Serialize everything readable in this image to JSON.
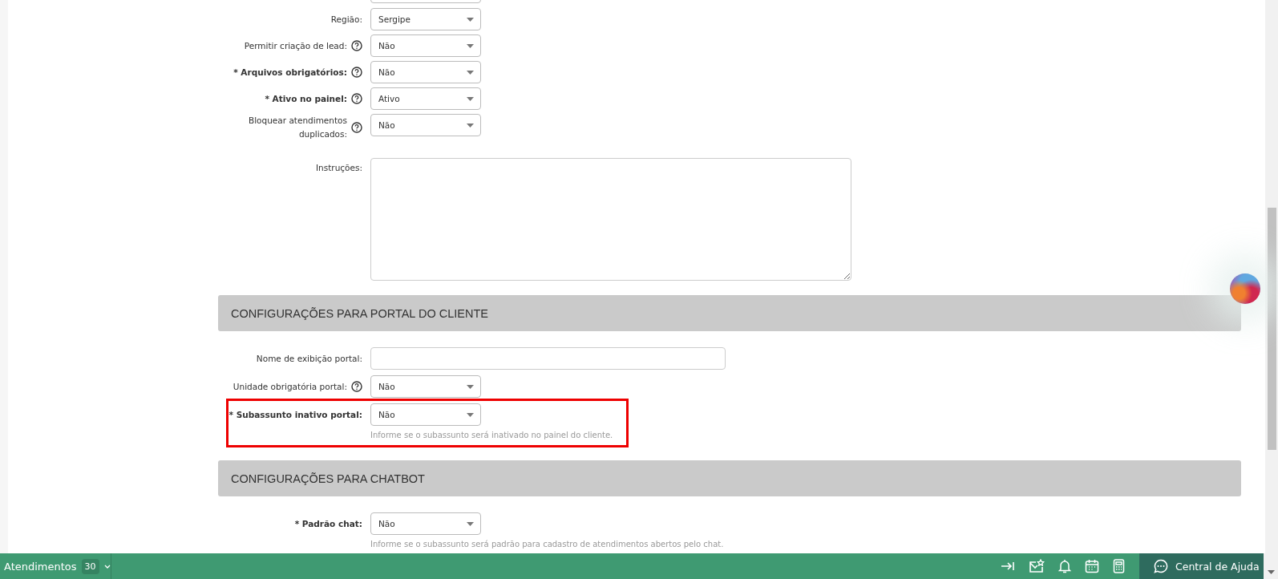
{
  "top_fields": [
    {
      "kind": "partial"
    },
    {
      "kind": "select",
      "label": "Região:",
      "required": false,
      "help": false,
      "value": "Sergipe"
    },
    {
      "kind": "select",
      "label": "Permitir criação de lead:",
      "required": false,
      "help": true,
      "value": "Não"
    },
    {
      "kind": "select",
      "label": "* Arquivos obrigatórios:",
      "required": true,
      "help": true,
      "value": "Não"
    },
    {
      "kind": "select",
      "label": "* Ativo no painel:",
      "required": true,
      "help": true,
      "value": "Ativo"
    },
    {
      "kind": "select",
      "label": "Bloquear atendimentos duplicados:",
      "required": false,
      "help": true,
      "value": "Não"
    },
    {
      "kind": "textarea",
      "label": "Instruções:",
      "required": false,
      "help": false
    }
  ],
  "sections": [
    {
      "title": "CONFIGURAÇÕES PARA PORTAL DO CLIENTE",
      "fields": [
        {
          "kind": "text",
          "label": "Nome de exibição portal:",
          "required": false,
          "help": false,
          "highlighted": false
        },
        {
          "kind": "select",
          "label": "Unidade obrigatória portal:",
          "required": false,
          "help": true,
          "value": "Não",
          "highlighted": false
        },
        {
          "kind": "select",
          "label": "* Subassunto inativo portal:",
          "required": true,
          "help": false,
          "value": "Não",
          "hint": "Informe se o subassunto será inativado no painel do cliente.",
          "highlighted": true
        }
      ]
    },
    {
      "title": "CONFIGURAÇÕES PARA CHATBOT",
      "fields": [
        {
          "kind": "select",
          "label": "* Padrão chat:",
          "required": true,
          "help": false,
          "value": "Não",
          "hint": "Informe se o subassunto será padrão para cadastro de atendimentos abertos pelo chat.",
          "highlighted": false
        }
      ]
    }
  ],
  "bottom_bar": {
    "queue_label": "Atendimentos",
    "queue_count": "30",
    "help_label": "Central de Ajuda"
  }
}
